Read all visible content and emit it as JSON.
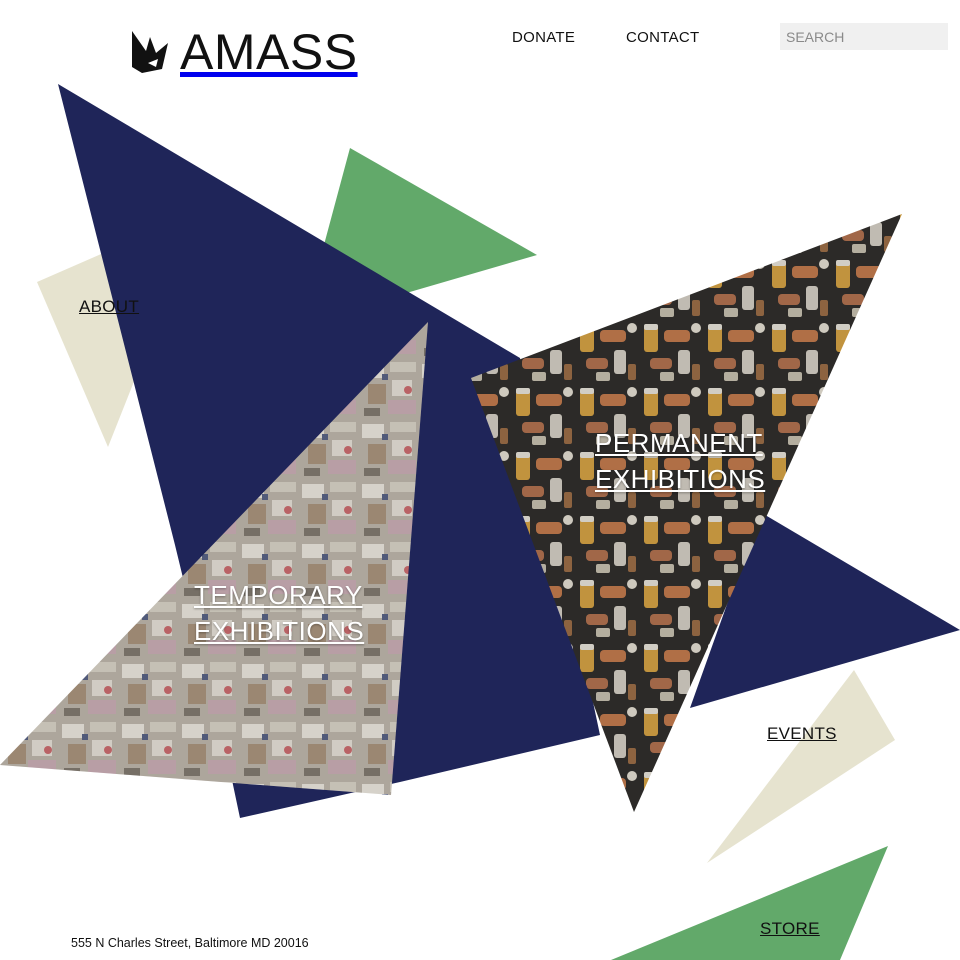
{
  "brand": {
    "name": "AMASS",
    "logo_icon": "bird-origami-icon"
  },
  "nav": {
    "donate_label": "DONATE",
    "contact_label": "CONTACT"
  },
  "search": {
    "placeholder": "SEARCH",
    "value": ""
  },
  "sections": {
    "about_label": "ABOUT",
    "events_label": "EVENTS",
    "store_label": "STORE",
    "temporary": {
      "line1": "TEMPORARY",
      "line2": "EXHIBITIONS"
    },
    "permanent": {
      "line1": "PERMANENT",
      "line2": "EXHIBITIONS"
    }
  },
  "footer": {
    "address": "555 N Charles Street, Baltimore MD 20016"
  },
  "colors": {
    "navy": "#1f2559",
    "green": "#62a96a",
    "beige": "#e6e3cf",
    "white": "#ffffff"
  }
}
